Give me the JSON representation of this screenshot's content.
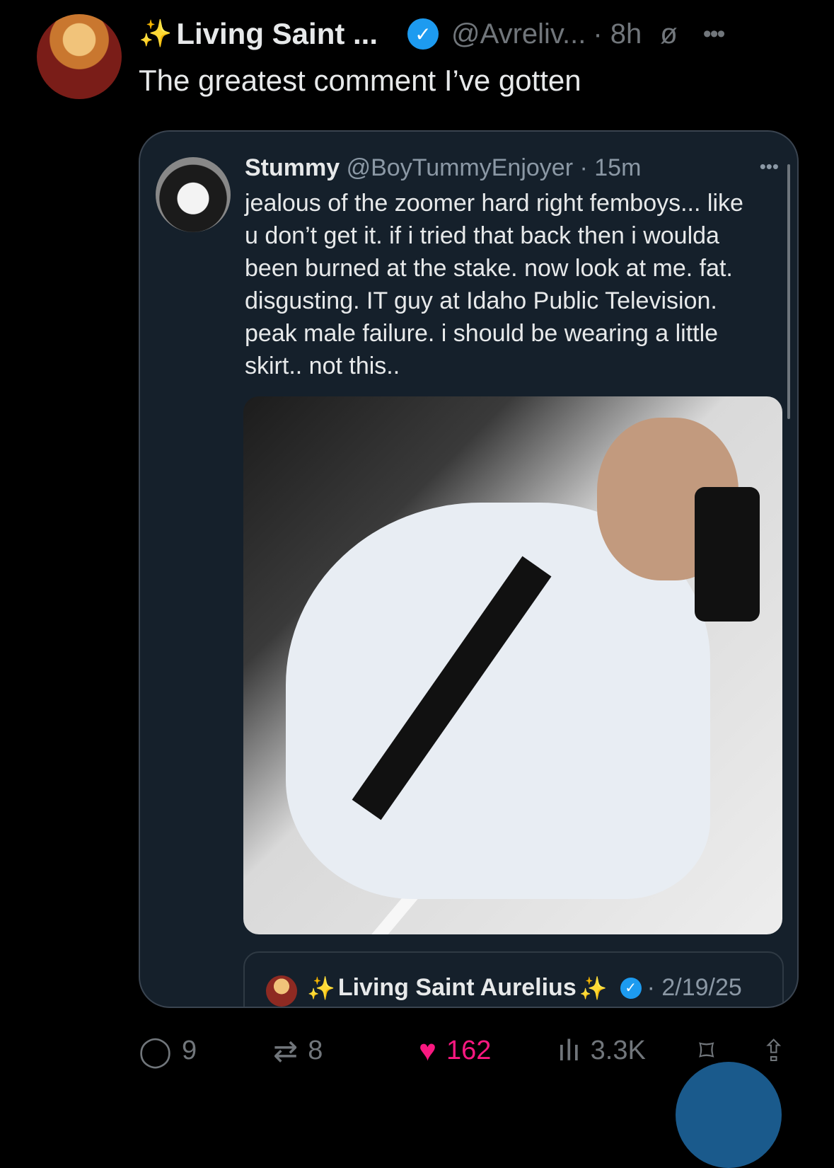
{
  "post": {
    "sparkle": "✨",
    "display_name": "Living Saint ...",
    "verified_glyph": "✓",
    "handle": "@Avreliv...",
    "time": "· 8h",
    "grok_icon": "ø",
    "more": "•••",
    "text": "The greatest comment I’ve gotten"
  },
  "quote": {
    "name": "Stummy",
    "handle": "@BoyTummyEnjoyer",
    "time": "· 15m",
    "more": "•••",
    "text": "jealous of the zoomer hard right femboys... like\nu don’t get it. if i tried that back then i woulda\nbeen burned at the stake. now look at me. fat.\ndisgusting. IT guy at Idaho Public Television.\npeak male failure. i should be wearing a little\nskirt.. not this..",
    "nested": {
      "sparkle_left": "✨",
      "name": "Living Saint Aurelius",
      "sparkle_right": "✨",
      "verified_glyph": "✓",
      "date": "· 2/19/25"
    }
  },
  "actions": {
    "reply": {
      "icon": "reply-icon",
      "glyph": "◯",
      "count": "9"
    },
    "repost": {
      "icon": "repost-icon",
      "glyph": "⇄",
      "count": "8"
    },
    "like": {
      "icon": "heart-icon",
      "glyph": "♥",
      "count": "162",
      "color": "#f91880"
    },
    "views": {
      "icon": "views-icon",
      "glyph": "ılı",
      "count": "3.3K"
    },
    "bookmark": {
      "icon": "bookmark-icon",
      "glyph": "⌑"
    },
    "share": {
      "icon": "share-icon",
      "glyph": "⇪"
    }
  },
  "colors": {
    "background": "#000000",
    "card": "#15202b",
    "accent": "#1d9bf0",
    "like": "#f91880"
  }
}
